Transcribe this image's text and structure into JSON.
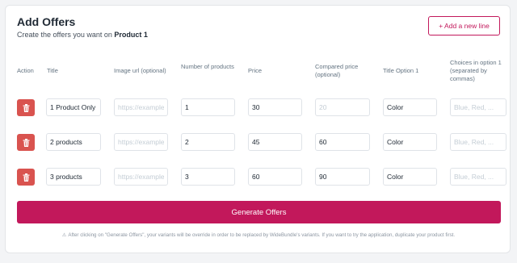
{
  "header": {
    "title": "Add Offers",
    "subtitle_prefix": "Create the offers you want on ",
    "subtitle_product": "Product 1",
    "add_button": "+ Add a new line"
  },
  "columns": {
    "action": "Action",
    "title": "Title",
    "image": "Image url (optional)",
    "number": "Number of products",
    "price": "Price",
    "compared": "Compared price (optional)",
    "option_title": "Title Option 1",
    "choices": "Choices in option 1 (separated by commas)"
  },
  "placeholders": {
    "image": "https://example",
    "compared": "20",
    "choices": "Blue, Red, ..."
  },
  "rows": [
    {
      "title": "1 Product Only",
      "image": "",
      "number": "1",
      "price": "30",
      "compared": "",
      "option_title": "Color",
      "choices": ""
    },
    {
      "title": "2 products",
      "image": "",
      "number": "2",
      "price": "45",
      "compared": "60",
      "option_title": "Color",
      "choices": ""
    },
    {
      "title": "3 products",
      "image": "",
      "number": "3",
      "price": "60",
      "compared": "90",
      "option_title": "Color",
      "choices": ""
    }
  ],
  "generate_button": "Generate Offers",
  "footnote": "After clicking on \"Generate Offers\", your variants will be override in order to be replaced by WideBundle's variants. If you want to try the application, duplicate your product first.",
  "footnote_icon": "warning-icon",
  "colors": {
    "primary": "#c2185b",
    "delete": "#d9534f"
  }
}
